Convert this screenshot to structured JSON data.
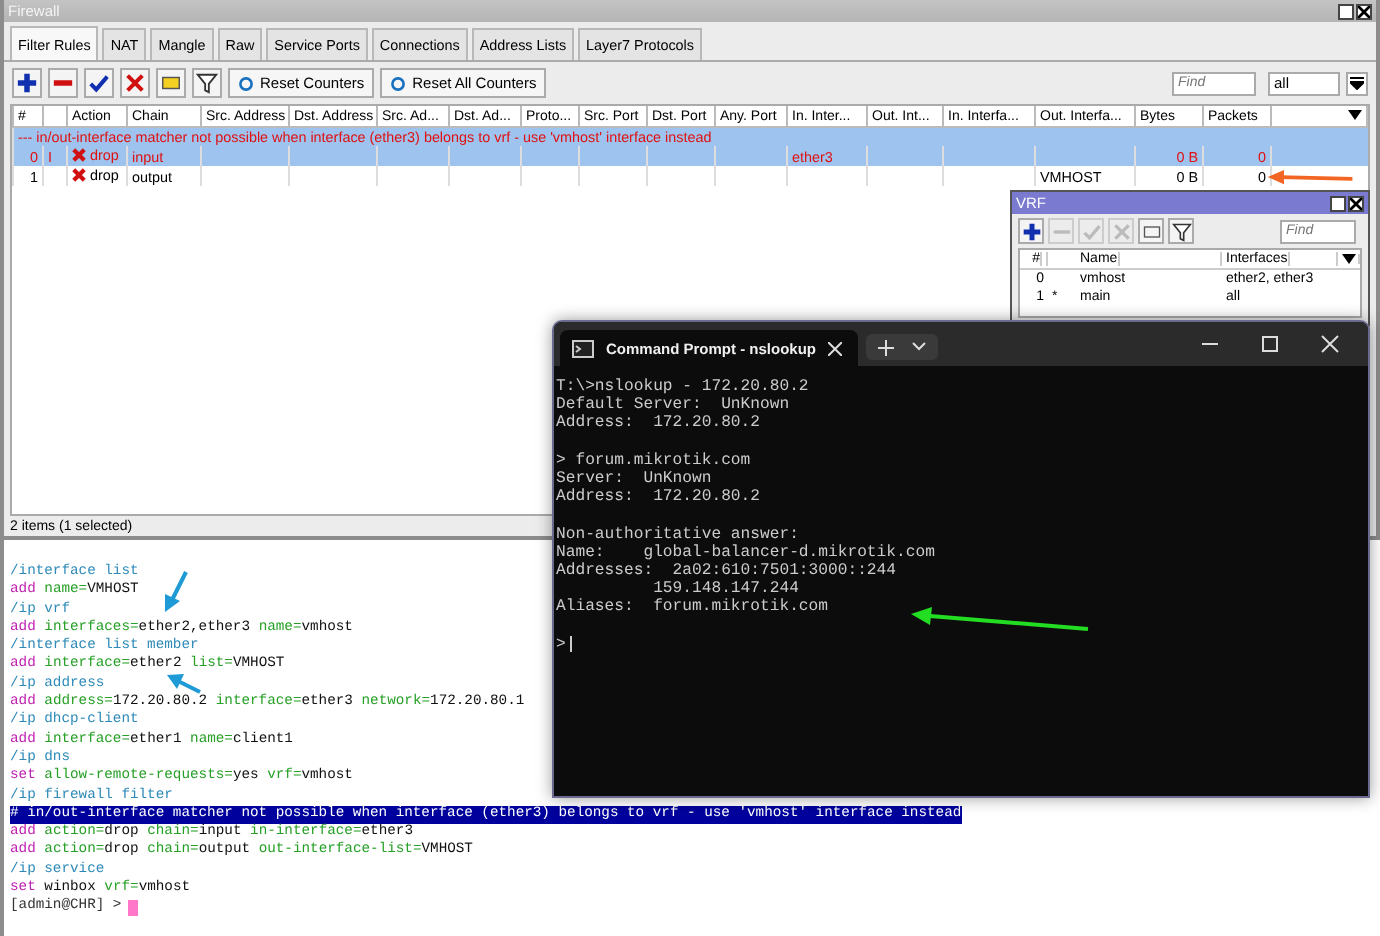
{
  "firewall": {
    "title": "Firewall",
    "tabs": [
      {
        "label": "Filter Rules",
        "selected": true
      },
      {
        "label": "NAT",
        "selected": false
      },
      {
        "label": "Mangle",
        "selected": false
      },
      {
        "label": "Raw",
        "selected": false
      },
      {
        "label": "Service Ports",
        "selected": false
      },
      {
        "label": "Connections",
        "selected": false
      },
      {
        "label": "Address Lists",
        "selected": false
      },
      {
        "label": "Layer7 Protocols",
        "selected": false
      }
    ],
    "toolbar": [
      {
        "kind": "add",
        "disabled": false
      },
      {
        "kind": "remove",
        "disabled": false
      },
      {
        "kind": "enable",
        "disabled": false
      },
      {
        "kind": "disable",
        "disabled": false
      },
      {
        "kind": "comment",
        "disabled": false
      },
      {
        "kind": "filter",
        "disabled": false
      }
    ],
    "buttons": [
      "Reset Counters",
      "Reset All Counters"
    ],
    "find": {
      "placeholder": "Find"
    },
    "filter_select": "all",
    "table": {
      "columns": [
        "#",
        "Action",
        "Chain",
        "Src. Address",
        "Dst. Address",
        "Src. Ad...",
        "Dst. Ad...",
        "Proto...",
        "Src. Port",
        "Dst. Port",
        "Any. Port",
        "In. Inter...",
        "Out. Int...",
        "In. Interfa...",
        "Out. Interfa...",
        "Bytes",
        "Packets"
      ],
      "rows": [
        {
          "comment": "--- in/out-interface matcher not possible when interface (ether3) belongs to vrf - use 'vmhost' interface instead",
          "number": "0",
          "flag": "I",
          "action": "drop",
          "chain": "input",
          "in_interface": "ether3",
          "bytes": "0 B",
          "packets": "0",
          "selected": true,
          "invalid": true
        },
        {
          "number": "1",
          "action": "drop",
          "chain": "output",
          "out_interface": "VMHOST",
          "bytes": "0 B",
          "packets": "0",
          "selected": false,
          "invalid": false
        }
      ]
    },
    "status_bar": "2 items (1 selected)"
  },
  "vrf": {
    "title": "VRF",
    "toolbar": [
      {
        "kind": "add",
        "disabled": false
      },
      {
        "kind": "remove",
        "disabled": true
      },
      {
        "kind": "enable",
        "disabled": true
      },
      {
        "kind": "disable",
        "disabled": true
      },
      {
        "kind": "comment",
        "disabled": false
      },
      {
        "kind": "filter",
        "disabled": false
      }
    ],
    "find": {
      "placeholder": "Find"
    },
    "columns": [
      "#",
      "Name",
      "Interfaces"
    ],
    "rows": [
      {
        "number": "0",
        "name": "vmhost",
        "interfaces": "ether2, ether3"
      },
      {
        "number": "1",
        "flag": "*",
        "name": "main",
        "interfaces": "all"
      }
    ]
  },
  "console": {
    "lines": [
      {
        "kind": "path",
        "text": "/interface list"
      },
      {
        "kind": "command",
        "text": "add name=VMHOST"
      },
      {
        "kind": "path",
        "text": "/ip vrf"
      },
      {
        "kind": "command",
        "text": "add interfaces=ether2,ether3 name=vmhost"
      },
      {
        "kind": "path",
        "text": "/interface list member"
      },
      {
        "kind": "command",
        "text": "add interface=ether2 list=VMHOST"
      },
      {
        "kind": "path",
        "text": "/ip address"
      },
      {
        "kind": "command",
        "text": "add address=172.20.80.2 interface=ether3 network=172.20.80.1"
      },
      {
        "kind": "path",
        "text": "/ip dhcp-client"
      },
      {
        "kind": "command",
        "text": "add interface=ether1 name=client1"
      },
      {
        "kind": "path",
        "text": "/ip dns"
      },
      {
        "kind": "command",
        "text": "set allow-remote-requests=yes vrf=vmhost"
      },
      {
        "kind": "path",
        "text": "/ip firewall filter"
      },
      {
        "kind": "comment",
        "text": "# in/out-interface matcher not possible when interface (ether3) belongs to vrf - use 'vmhost' interface instead"
      },
      {
        "kind": "command",
        "text": "add action=drop chain=input in-interface=ether3"
      },
      {
        "kind": "command",
        "text": "add action=drop chain=output out-interface-list=VMHOST"
      },
      {
        "kind": "path",
        "text": "/ip service"
      },
      {
        "kind": "command",
        "text": "set winbox vrf=vmhost"
      },
      {
        "kind": "prompt",
        "text": "[admin@CHR] >"
      }
    ]
  },
  "cmd": {
    "tab_title": "Command Prompt - nslookup",
    "blocks": [
      [
        "T:\\>nslookup - 172.20.80.2",
        "Default Server:  UnKnown",
        "Address:  172.20.80.2"
      ],
      [
        "> forum.mikrotik.com",
        "Server:  UnKnown",
        "Address:  172.20.80.2"
      ],
      [
        "Non-authoritative answer:",
        "Name:    global-balancer-d.mikrotik.com",
        "Addresses:  2a02:610:7501:3000::244",
        "          159.148.147.244",
        "Aliases:  forum.mikrotik.com"
      ]
    ],
    "prompt": ">"
  }
}
